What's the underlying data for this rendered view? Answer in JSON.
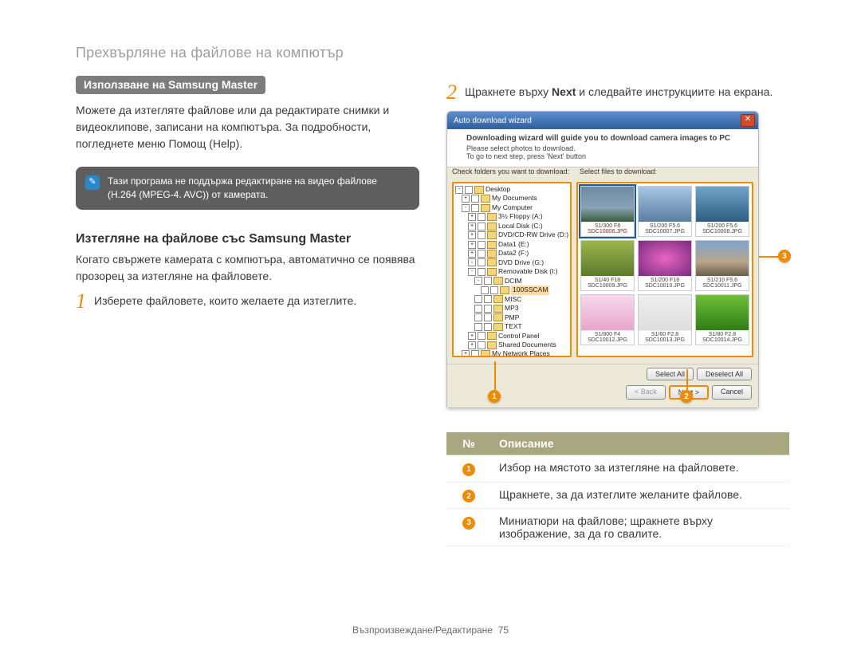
{
  "page_title": "Прехвърляне на файлове на компютър",
  "section_badge": "Използване на Samsung Master",
  "intro_para": "Можете да изтегляте файлове или да редактирате снимки и видеоклипове, записани на компютъра. За подробности, погледнете меню Помощ (Help).",
  "note_text": "Тази програма не поддържа редактиране на видео файлове (H.264 (MPEG-4. AVC)) от камерата.",
  "sub_heading": "Изтегляне на файлове със Samsung Master",
  "sub_para": "Когато свържете камерата с компютъра, автоматично се появява прозорец за изтегляне на файловете.",
  "step1": {
    "num": "1",
    "text": "Изберете файловете, които желаете да изтеглите."
  },
  "step2": {
    "num": "2",
    "pre": "Щракнете върху ",
    "bold": "Next",
    "post": " и следвайте инструкциите на екрана."
  },
  "window": {
    "title": "Auto download wizard",
    "banner_bold": "Downloading wizard will guide you to download camera images to PC",
    "banner_l1": "Please select photos to download.",
    "banner_l2": "To go to next step, press 'Next' button",
    "label_tree": "Check folders you want to download:",
    "label_thumbs": "Select files to download:",
    "tree": [
      {
        "ind": 0,
        "exp": "-",
        "name": "Desktop"
      },
      {
        "ind": 1,
        "exp": "+",
        "name": "My Documents"
      },
      {
        "ind": 1,
        "exp": "-",
        "name": "My Computer"
      },
      {
        "ind": 2,
        "exp": "+",
        "name": "3½ Floppy (A:)"
      },
      {
        "ind": 2,
        "exp": "+",
        "name": "Local Disk (C:)"
      },
      {
        "ind": 2,
        "exp": "+",
        "name": "DVD/CD-RW Drive (D:)"
      },
      {
        "ind": 2,
        "exp": "+",
        "name": "Data1 (E:)"
      },
      {
        "ind": 2,
        "exp": "+",
        "name": "Data2 (F:)"
      },
      {
        "ind": 2,
        "exp": "-",
        "name": "DVD Drive (G:)"
      },
      {
        "ind": 2,
        "exp": "-",
        "name": "Removable Disk (I:)"
      },
      {
        "ind": 3,
        "exp": "-",
        "name": "DCIM"
      },
      {
        "ind": 4,
        "exp": " ",
        "name": "100SSCAM",
        "hl": true
      },
      {
        "ind": 3,
        "exp": " ",
        "name": "MISC"
      },
      {
        "ind": 3,
        "exp": " ",
        "name": "MP3"
      },
      {
        "ind": 3,
        "exp": " ",
        "name": "PMP"
      },
      {
        "ind": 3,
        "exp": " ",
        "name": "TEXT"
      },
      {
        "ind": 2,
        "exp": "+",
        "name": "Control Panel"
      },
      {
        "ind": 2,
        "exp": "+",
        "name": "Shared Documents"
      },
      {
        "ind": 1,
        "exp": "+",
        "name": "My Network Places"
      }
    ],
    "thumbs": [
      {
        "cls": "g-mtn",
        "info": "S1/300 F8",
        "name": "SDC10006.JPG",
        "sel": true
      },
      {
        "cls": "g-dock",
        "info": "S1/200 F5.6",
        "name": "SDC10007.JPG"
      },
      {
        "cls": "g-water",
        "info": "S1/200 F5.6",
        "name": "SDC10008.JPG"
      },
      {
        "cls": "g-field",
        "info": "S1/40 F18",
        "name": "SDC10009.JPG"
      },
      {
        "cls": "g-flower",
        "info": "S1/200 F18",
        "name": "SDC10010.JPG"
      },
      {
        "cls": "g-city",
        "info": "S1/210 F5.6",
        "name": "SDC10011.JPG"
      },
      {
        "cls": "g-blossom",
        "info": "S1/800 F4",
        "name": "SDC10012.JPG"
      },
      {
        "cls": "g-text",
        "info": "S1/60 F2.8",
        "name": "SDC10013.JPG"
      },
      {
        "cls": "g-leaf",
        "info": "S1/80 F2.8",
        "name": "SDC10014.JPG"
      }
    ],
    "btn_select_all": "Select All",
    "btn_deselect_all": "Deselect All",
    "btn_back": "< Back",
    "btn_next": "Next >",
    "btn_cancel": "Cancel"
  },
  "callouts": {
    "c1": "1",
    "c2": "2",
    "c3": "3"
  },
  "table": {
    "h_num": "№",
    "h_desc": "Описание",
    "rows": [
      {
        "n": "1",
        "d": "Избор на мястото за изтегляне на файловете."
      },
      {
        "n": "2",
        "d": "Щракнете, за да изтеглите желаните файлове."
      },
      {
        "n": "3",
        "d": "Миниатюри на файлове; щракнете върху изображение, за да го свалите."
      }
    ]
  },
  "footer_text": "Възпроизвеждане/Редактиране",
  "footer_page": "75"
}
